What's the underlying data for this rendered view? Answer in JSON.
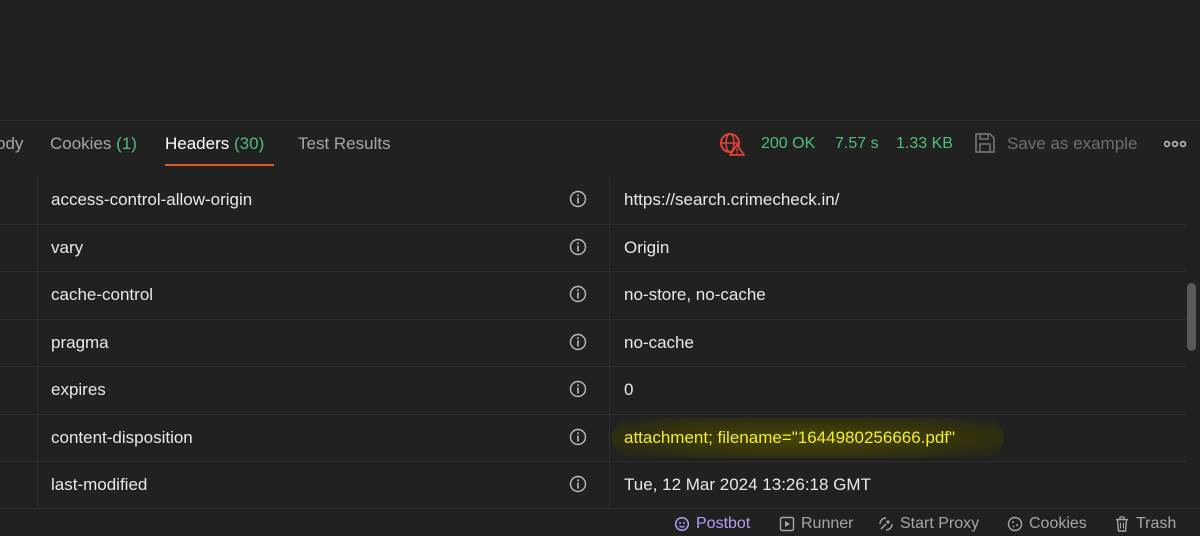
{
  "tabs": [
    {
      "label": "ody",
      "count": ""
    },
    {
      "label": "Cookies",
      "count": "(1)"
    },
    {
      "label": "Headers",
      "count": "(30)"
    },
    {
      "label": "Test Results",
      "count": ""
    }
  ],
  "status": {
    "code": "200 OK",
    "time": "7.57 s",
    "size": "1.33 KB",
    "save_label": "Save as example"
  },
  "headers": [
    {
      "key": "access-control-allow-origin",
      "value": "https://search.crimecheck.in/"
    },
    {
      "key": "vary",
      "value": "Origin"
    },
    {
      "key": "cache-control",
      "value": "no-store, no-cache"
    },
    {
      "key": "pragma",
      "value": "no-cache"
    },
    {
      "key": "expires",
      "value": "0"
    },
    {
      "key": "content-disposition",
      "value": "attachment; filename=\"1644980256666.pdf\""
    },
    {
      "key": "last-modified",
      "value": "Tue, 12 Mar 2024 13:26:18 GMT"
    }
  ],
  "footer": {
    "postbot": "Postbot",
    "runner": "Runner",
    "proxy": "Start Proxy",
    "cookies": "Cookies",
    "trash": "Trash"
  },
  "colors": {
    "accent": "#e05a2b",
    "success": "#4fbf7a",
    "highlight": "#f1ee2a",
    "postbot": "#b79cf5"
  }
}
